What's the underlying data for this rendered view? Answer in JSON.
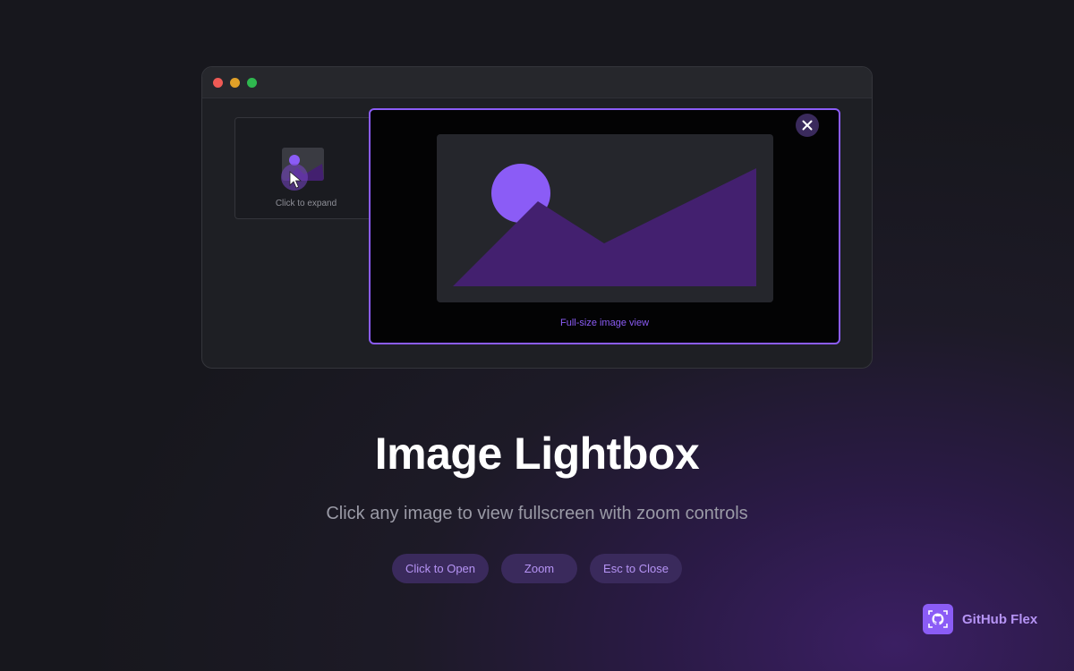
{
  "window": {
    "thumbnail": {
      "caption": "Click to expand"
    },
    "lightbox": {
      "caption": "Full-size image view"
    }
  },
  "hero": {
    "title": "Image Lightbox",
    "subtitle": "Click any image to view fullscreen with zoom controls"
  },
  "pills": [
    {
      "label": "Click to Open"
    },
    {
      "label": "Zoom"
    },
    {
      "label": "Esc to Close"
    }
  ],
  "brand": {
    "name": "GitHub Flex",
    "icon": "github-icon"
  },
  "colors": {
    "accent": "#8b5cf6",
    "accent_dark": "#3a2a5c",
    "mountain": "#43206f"
  }
}
